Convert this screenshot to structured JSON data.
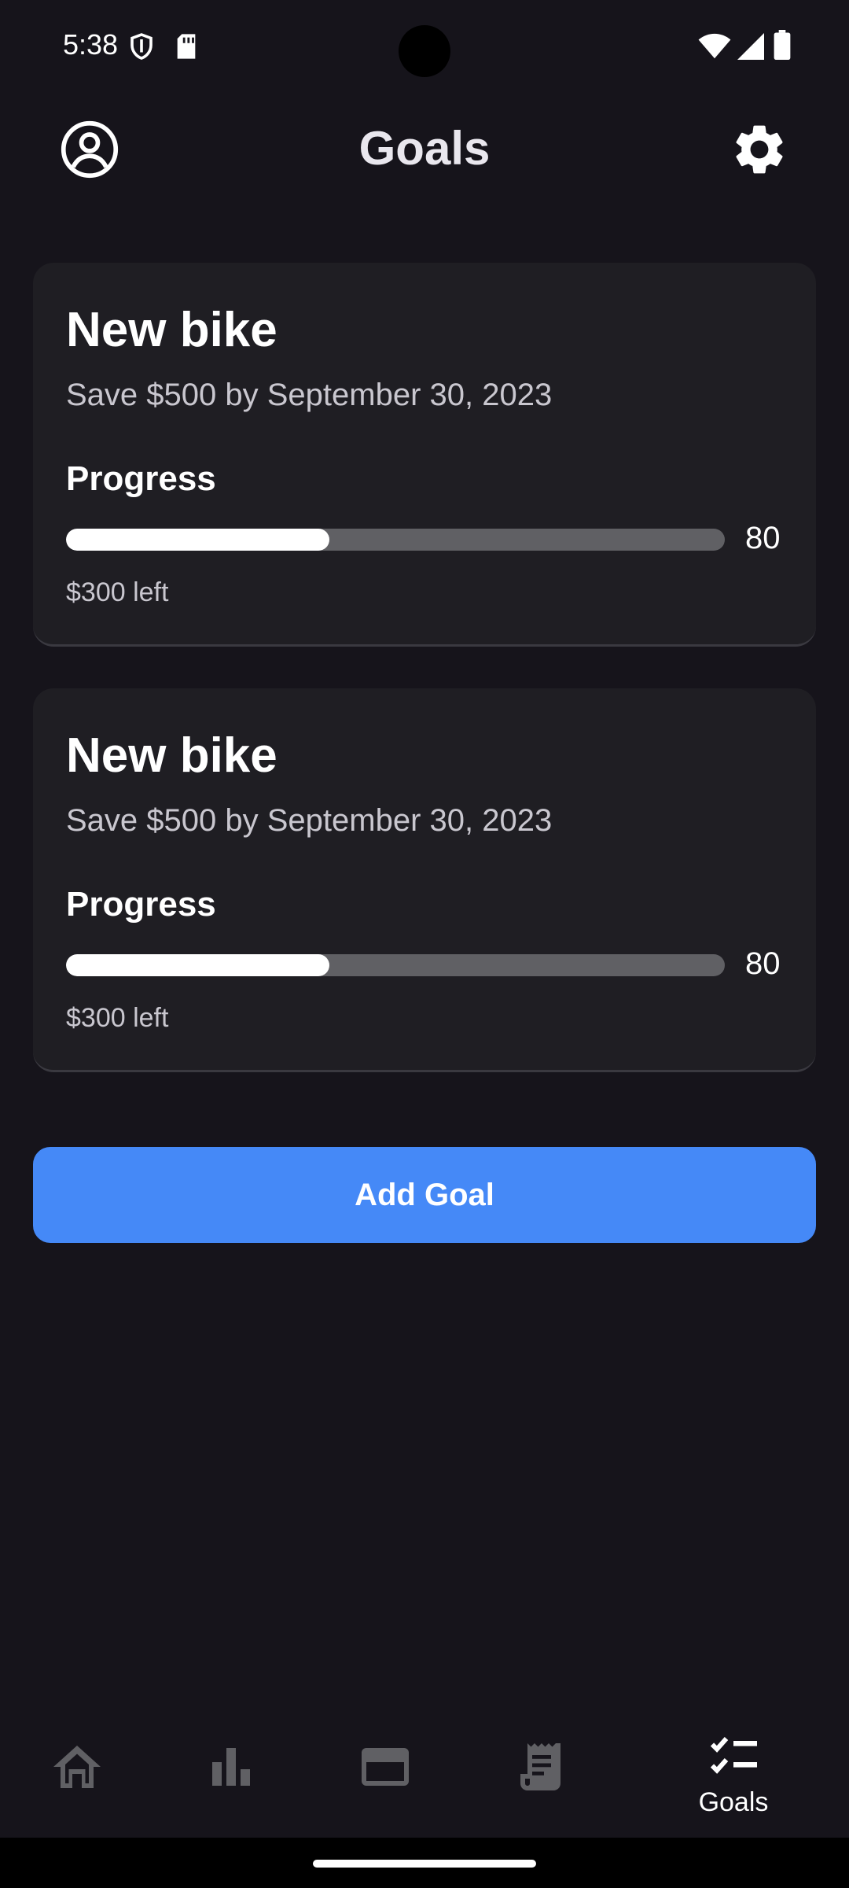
{
  "status_bar": {
    "time": "5:38"
  },
  "header": {
    "title": "Goals"
  },
  "goals": [
    {
      "title": "New bike",
      "description": "Save $500 by September 30, 2023",
      "progress_label": "Progress",
      "progress_value": "80",
      "progress_fraction": 0.4,
      "remaining": "$300 left"
    },
    {
      "title": "New bike",
      "description": "Save $500 by September 30, 2023",
      "progress_label": "Progress",
      "progress_value": "80",
      "progress_fraction": 0.4,
      "remaining": "$300 left"
    }
  ],
  "add_goal_label": "Add Goal",
  "bottom_nav": {
    "items": [
      {
        "icon": "home-icon",
        "label": ""
      },
      {
        "icon": "bar-chart-icon",
        "label": ""
      },
      {
        "icon": "credit-card-icon",
        "label": ""
      },
      {
        "icon": "receipt-icon",
        "label": ""
      },
      {
        "icon": "checklist-icon",
        "label": "Goals",
        "active": true
      }
    ]
  },
  "colors": {
    "background": "#16141b",
    "card": "#1f1e23",
    "accent": "#4589f7",
    "inactive_icon": "#606064"
  }
}
